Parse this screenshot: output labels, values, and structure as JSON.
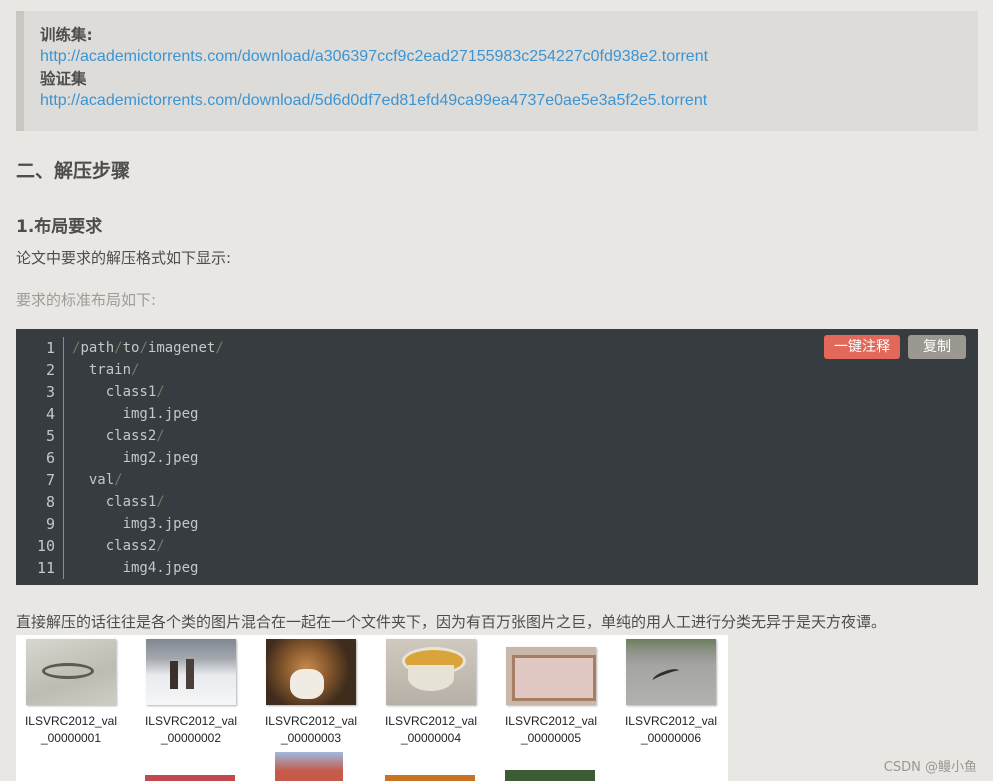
{
  "links": {
    "train_label": "训练集:",
    "train_url": "http://academictorrents.com/download/a306397ccf9c2ead27155983c254227c0fd938e2.torrent",
    "val_label": "验证集",
    "val_url": "http://academictorrents.com/download/5d6d0df7ed81efd49ca99ea4737e0ae5e3a5f2e5.torrent"
  },
  "section_title": "二、解压步骤",
  "subsection_title": "1.布局要求",
  "para_intro": "论文中要求的解压格式如下显示:",
  "para_standard": "要求的标准布局如下:",
  "code": {
    "annotate_button": "一键注释",
    "copy_button": "复制",
    "line_numbers": [
      "1",
      "2",
      "3",
      "4",
      "5",
      "6",
      "7",
      "8",
      "9",
      "10",
      "11"
    ]
  },
  "para_note": "直接解压的话往往是各个类的图片混合在一起在一个文件夹下，因为有百万张图片之巨，单纯的用人工进行分类无异于是天方夜谭。",
  "gallery": {
    "captions": [
      {
        "l1": "ILSVRC2012_val",
        "l2": "_00000001"
      },
      {
        "l1": "ILSVRC2012_val",
        "l2": "_00000002"
      },
      {
        "l1": "ILSVRC2012_val",
        "l2": "_00000003"
      },
      {
        "l1": "ILSVRC2012_val",
        "l2": "_00000004"
      },
      {
        "l1": "ILSVRC2012_val",
        "l2": "_00000005"
      },
      {
        "l1": "ILSVRC2012_val",
        "l2": "_00000006"
      }
    ]
  },
  "watermark": "CSDN @鳗小鱼"
}
